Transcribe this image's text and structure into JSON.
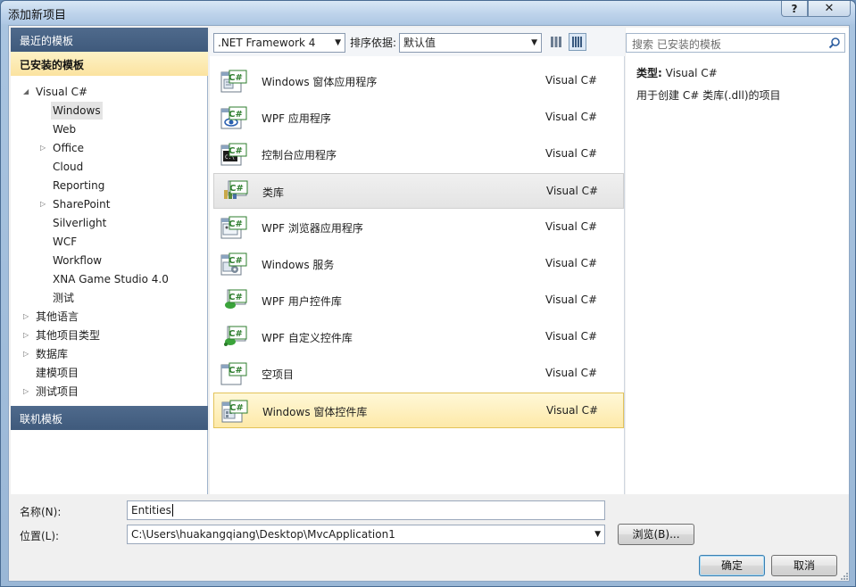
{
  "window": {
    "title": "添加新项目",
    "help_glyph": "?",
    "close_glyph": "✕"
  },
  "left_panel": {
    "recent_header": "最近的模板",
    "installed_header": "已安装的模板",
    "online_header": "联机模板",
    "tree": [
      {
        "label": "Visual C#",
        "arrow": "◢"
      },
      {
        "label": "Windows",
        "arrow": ""
      },
      {
        "label": "Web",
        "arrow": ""
      },
      {
        "label": "Office",
        "arrow": "▷"
      },
      {
        "label": "Cloud",
        "arrow": ""
      },
      {
        "label": "Reporting",
        "arrow": ""
      },
      {
        "label": "SharePoint",
        "arrow": "▷"
      },
      {
        "label": "Silverlight",
        "arrow": ""
      },
      {
        "label": "WCF",
        "arrow": ""
      },
      {
        "label": "Workflow",
        "arrow": ""
      },
      {
        "label": "XNA Game Studio 4.0",
        "arrow": ""
      },
      {
        "label": "测试",
        "arrow": ""
      },
      {
        "label": "其他语言",
        "arrow": "▷"
      },
      {
        "label": "其他项目类型",
        "arrow": "▷"
      },
      {
        "label": "数据库",
        "arrow": "▷"
      },
      {
        "label": "建模项目",
        "arrow": ""
      },
      {
        "label": "测试项目",
        "arrow": "▷"
      }
    ]
  },
  "toolbar": {
    "framework": ".NET Framework 4",
    "sort_label": "排序依据:",
    "sort_value": "默认值",
    "caret": "▼"
  },
  "templates": [
    {
      "name": "Windows 窗体应用程序",
      "lang": "Visual C#",
      "icon": "winforms-app-icon"
    },
    {
      "name": "WPF 应用程序",
      "lang": "Visual C#",
      "icon": "wpf-app-icon"
    },
    {
      "name": "控制台应用程序",
      "lang": "Visual C#",
      "icon": "console-app-icon"
    },
    {
      "name": "类库",
      "lang": "Visual C#",
      "icon": "class-library-icon"
    },
    {
      "name": "WPF 浏览器应用程序",
      "lang": "Visual C#",
      "icon": "wpf-browser-app-icon"
    },
    {
      "name": "Windows 服务",
      "lang": "Visual C#",
      "icon": "windows-service-icon"
    },
    {
      "name": "WPF 用户控件库",
      "lang": "Visual C#",
      "icon": "wpf-user-control-icon"
    },
    {
      "name": "WPF 自定义控件库",
      "lang": "Visual C#",
      "icon": "wpf-custom-control-icon"
    },
    {
      "name": "空项目",
      "lang": "Visual C#",
      "icon": "empty-project-icon"
    },
    {
      "name": "Windows 窗体控件库",
      "lang": "Visual C#",
      "icon": "winforms-control-library-icon"
    }
  ],
  "right_panel": {
    "search_placeholder": "搜索 已安装的模板",
    "type_label": "类型:",
    "type_value": "Visual C#",
    "description": "用于创建 C# 类库(.dll)的项目"
  },
  "form": {
    "name_label": "名称(N):",
    "name_value": "Entities",
    "location_label": "位置(L):",
    "location_value": "C:\\Users\\huakangqiang\\Desktop\\MvcApplication1",
    "browse_label": "浏览(B)...",
    "ok_label": "确定",
    "cancel_label": "取消"
  },
  "colors": {
    "header_dark": "#4f6a8c",
    "selection_gold": "#fde9a8",
    "csharp_green": "#2d7d2d"
  }
}
